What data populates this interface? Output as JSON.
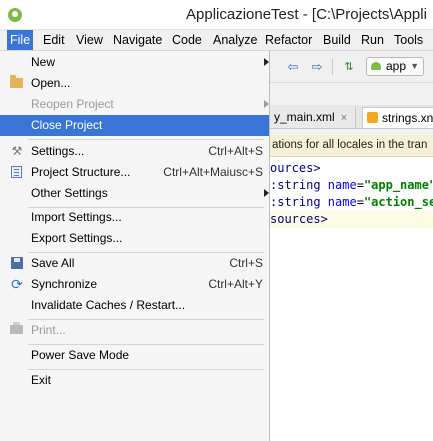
{
  "window": {
    "title": "ApplicazioneTest - [C:\\Projects\\Appli"
  },
  "menubar": {
    "items": [
      "File",
      "Edit",
      "View",
      "Navigate",
      "Code",
      "Analyze",
      "Refactor",
      "Build",
      "Run",
      "Tools"
    ],
    "active": "File"
  },
  "toolbar": {
    "back_icon": "arrow-left-icon",
    "forward_icon": "arrow-right-icon",
    "make_icon": "make-project-icon",
    "run_config_label": "app"
  },
  "tabs": [
    {
      "label": "y_main.xml",
      "close": "×"
    },
    {
      "label": "strings.xn"
    }
  ],
  "notice": {
    "text": "ations for all locales in the tran"
  },
  "editor": {
    "lines": [
      {
        "tag_open": "ources>",
        "attr": "",
        "eq": "",
        "val": ""
      },
      {
        "tag_open": ":string ",
        "attr": "name",
        "eq": "=",
        "val": "\"app_name\""
      },
      {
        "tag_open": ":string ",
        "attr": "name",
        "eq": "=",
        "val": "\"action_se"
      },
      {
        "tag_open": "sources>",
        "attr": "",
        "eq": "",
        "val": ""
      }
    ]
  },
  "file_menu": {
    "items": [
      {
        "label": "New",
        "icon": "",
        "shortcut": "",
        "submenu": true,
        "disabled": false
      },
      {
        "label": "Open...",
        "icon": "folder-icon",
        "shortcut": "",
        "submenu": false,
        "disabled": false
      },
      {
        "label": "Reopen Project",
        "icon": "",
        "shortcut": "",
        "submenu": true,
        "disabled": true
      },
      {
        "label": "Close Project",
        "icon": "",
        "shortcut": "",
        "submenu": false,
        "disabled": false,
        "selected": true
      },
      {
        "label": "Settings...",
        "icon": "wrench-icon",
        "shortcut": "Ctrl+Alt+S",
        "submenu": false,
        "disabled": false
      },
      {
        "label": "Project Structure...",
        "icon": "project-structure-icon",
        "shortcut": "Ctrl+Alt+Maiusc+S",
        "submenu": false,
        "disabled": false
      },
      {
        "label": "Other Settings",
        "icon": "",
        "shortcut": "",
        "submenu": true,
        "disabled": false
      },
      {
        "label": "Import Settings...",
        "icon": "",
        "shortcut": "",
        "submenu": false,
        "disabled": false
      },
      {
        "label": "Export Settings...",
        "icon": "",
        "shortcut": "",
        "submenu": false,
        "disabled": false
      },
      {
        "label": "Save All",
        "icon": "save-icon",
        "shortcut": "Ctrl+S",
        "submenu": false,
        "disabled": false
      },
      {
        "label": "Synchronize",
        "icon": "sync-icon",
        "shortcut": "Ctrl+Alt+Y",
        "submenu": false,
        "disabled": false
      },
      {
        "label": "Invalidate Caches / Restart...",
        "icon": "",
        "shortcut": "",
        "submenu": false,
        "disabled": false
      },
      {
        "label": "Print...",
        "icon": "print-icon",
        "shortcut": "",
        "submenu": false,
        "disabled": true
      },
      {
        "label": "Power Save Mode",
        "icon": "",
        "shortcut": "",
        "submenu": false,
        "disabled": false
      },
      {
        "label": "Exit",
        "icon": "",
        "shortcut": "",
        "submenu": false,
        "disabled": false
      }
    ]
  },
  "colors": {
    "selection": "#3875d7",
    "menu_bg": "#f5f5f5",
    "disabled_text": "#9a9a9a"
  }
}
